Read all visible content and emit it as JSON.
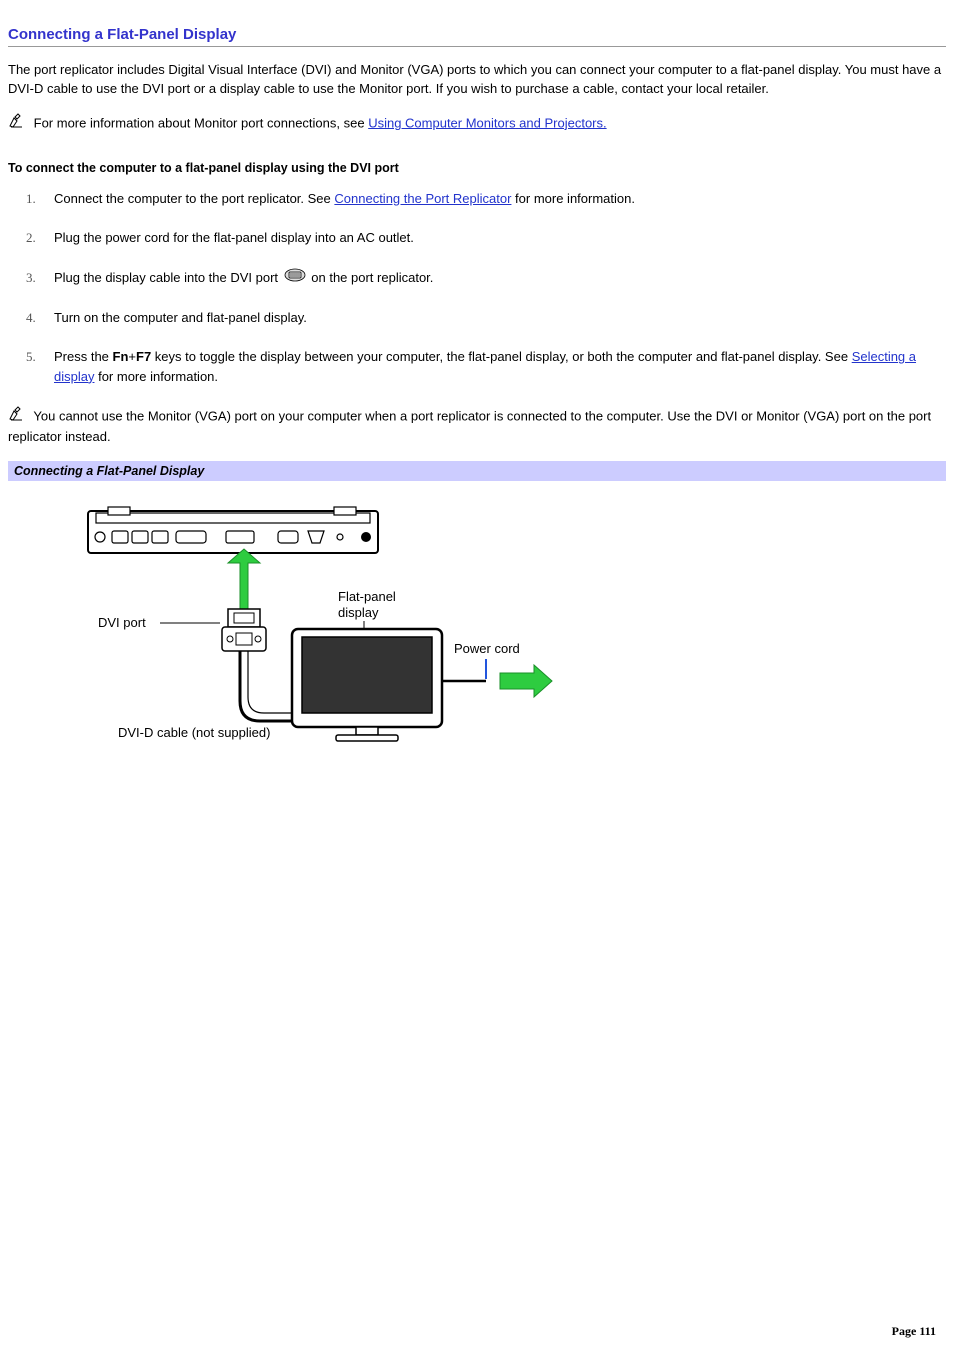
{
  "title": "Connecting a Flat-Panel Display",
  "intro": "The port replicator includes Digital Visual Interface (DVI) and Monitor (VGA) ports to which you can connect your computer to a flat-panel display. You must have a DVI-D cable to use the DVI port or a display cable to use the Monitor port. If you wish to purchase a cable, contact your local retailer.",
  "note1_pre": "For more information about Monitor port connections, see ",
  "note1_link": "Using Computer Monitors and Projectors.",
  "subheading": "To connect the computer to a flat-panel display using the DVI port",
  "steps": {
    "s1_pre": "Connect the computer to the port replicator. See ",
    "s1_link": "Connecting the Port Replicator",
    "s1_post": " for more information.",
    "s2": "Plug the power cord for the flat-panel display into an AC outlet.",
    "s3_pre": "Plug the display cable into the DVI port ",
    "s3_post": " on the port replicator.",
    "s4": "Turn on the computer and flat-panel display.",
    "s5_pre": "Press the ",
    "s5_fn": "Fn",
    "s5_plus": "+",
    "s5_f7": "F7",
    "s5_mid": " keys to toggle the display between your computer, the flat-panel display, or both the computer and flat-panel display. See ",
    "s5_link": "Selecting a display",
    "s5_post": " for more information."
  },
  "note2": "You cannot use the Monitor (VGA) port on your computer when a port replicator is connected to the computer. Use the DVI or Monitor (VGA) port on the port replicator instead.",
  "caption": "Connecting a Flat-Panel Display",
  "diagram": {
    "dvi_port": "DVI port",
    "flat_panel": "Flat-panel\ndisplay",
    "flat_panel_l1": "Flat-panel",
    "flat_panel_l2": "display",
    "power_cord": "Power cord",
    "cable": "DVI-D cable (not supplied)"
  },
  "footer": "Page 111"
}
